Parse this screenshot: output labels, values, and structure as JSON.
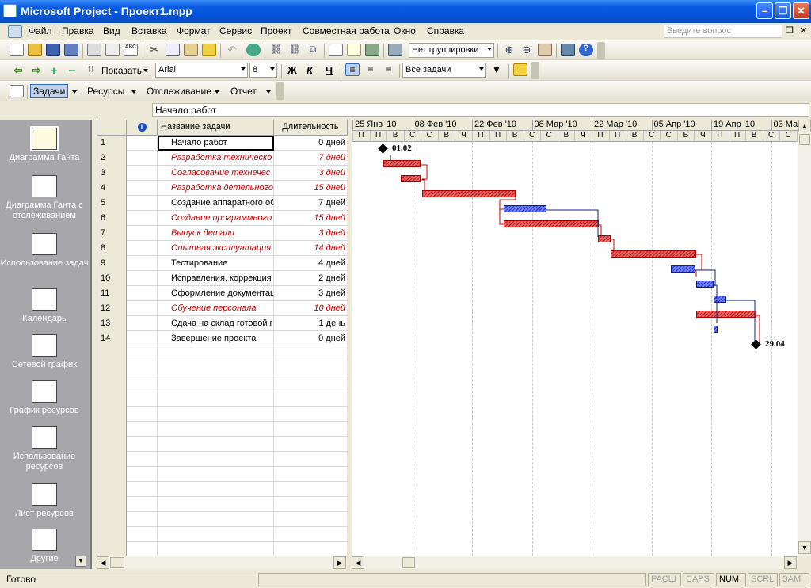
{
  "window": {
    "title": "Microsoft Project - Проект1.mpp"
  },
  "menu": {
    "items": [
      "Файл",
      "Правка",
      "Вид",
      "Вставка",
      "Формат",
      "Сервис",
      "Проект",
      "Совместная работа",
      "Окно",
      "Справка"
    ],
    "help_placeholder": "Введите вопрос"
  },
  "toolbar1": {
    "grouping": "Нет группировки"
  },
  "toolbar2": {
    "show_label": "Показать",
    "font": "Arial",
    "font_size": "8",
    "bold": "Ж",
    "italic": "К",
    "underline": "Ч",
    "filter": "Все задачи"
  },
  "toolbar3": {
    "tasks": "Задачи",
    "resources": "Ресурсы",
    "tracking": "Отслеживание",
    "report": "Отчет"
  },
  "entry_bar": {
    "value": "Начало работ"
  },
  "viewbar": {
    "items": [
      "Диаграмма Ганта",
      "Диаграмма Ганта с отслеживанием",
      "Использование задач",
      "Календарь",
      "Сетевой график",
      "График ресурсов",
      "Использование ресурсов",
      "Лист ресурсов",
      "Другие"
    ]
  },
  "grid": {
    "headers": {
      "info": "i",
      "name": "Название задачи",
      "duration": "Длительность"
    },
    "rows": [
      {
        "id": "1",
        "name": "Начало работ",
        "duration": "0 дней",
        "critical": false
      },
      {
        "id": "2",
        "name": "Разработка техническо",
        "duration": "7 дней",
        "critical": true
      },
      {
        "id": "3",
        "name": "Согласование технечес",
        "duration": "3 дней",
        "critical": true
      },
      {
        "id": "4",
        "name": "Разработка детельного",
        "duration": "15 дней",
        "critical": true
      },
      {
        "id": "5",
        "name": "Создание аппаратного об",
        "duration": "7 дней",
        "critical": false
      },
      {
        "id": "6",
        "name": "Создание программного",
        "duration": "15 дней",
        "critical": true
      },
      {
        "id": "7",
        "name": "Выпуск детали",
        "duration": "3 дней",
        "critical": true
      },
      {
        "id": "8",
        "name": "Опытная эксплуатация",
        "duration": "14 дней",
        "critical": true
      },
      {
        "id": "9",
        "name": "Тестирование",
        "duration": "4 дней",
        "critical": false
      },
      {
        "id": "10",
        "name": "Исправления, коррекция",
        "duration": "2 дней",
        "critical": false
      },
      {
        "id": "11",
        "name": "Оформление документаці",
        "duration": "3 дней",
        "critical": false
      },
      {
        "id": "12",
        "name": "Обучение персонала",
        "duration": "10 дней",
        "critical": true
      },
      {
        "id": "13",
        "name": "Сдача на склад готовой г",
        "duration": "1 день",
        "critical": false
      },
      {
        "id": "14",
        "name": "Завершение проекта",
        "duration": "0 дней",
        "critical": false
      }
    ]
  },
  "timescale": {
    "weeks": [
      "25 Янв '10",
      "08 Фев '10",
      "22 Фев '10",
      "08 Мар '10",
      "22 Мар '10",
      "05 Апр '10",
      "19 Апр '10",
      "03 Ма"
    ],
    "days": [
      "П",
      "П",
      "В",
      "С",
      "С",
      "В",
      "Ч",
      "П",
      "П",
      "В",
      "С",
      "С",
      "В",
      "Ч",
      "П",
      "П",
      "В",
      "С",
      "С",
      "В",
      "Ч",
      "П",
      "П",
      "В",
      "С",
      "С",
      "В"
    ]
  },
  "milestones": {
    "start_label": "01.02",
    "end_label": "29.04"
  },
  "status": {
    "ready": "Готово",
    "indicators": [
      "РАСШ",
      "CAPS",
      "NUM",
      "SCRL",
      "ЗАМ"
    ],
    "active": "NUM"
  }
}
